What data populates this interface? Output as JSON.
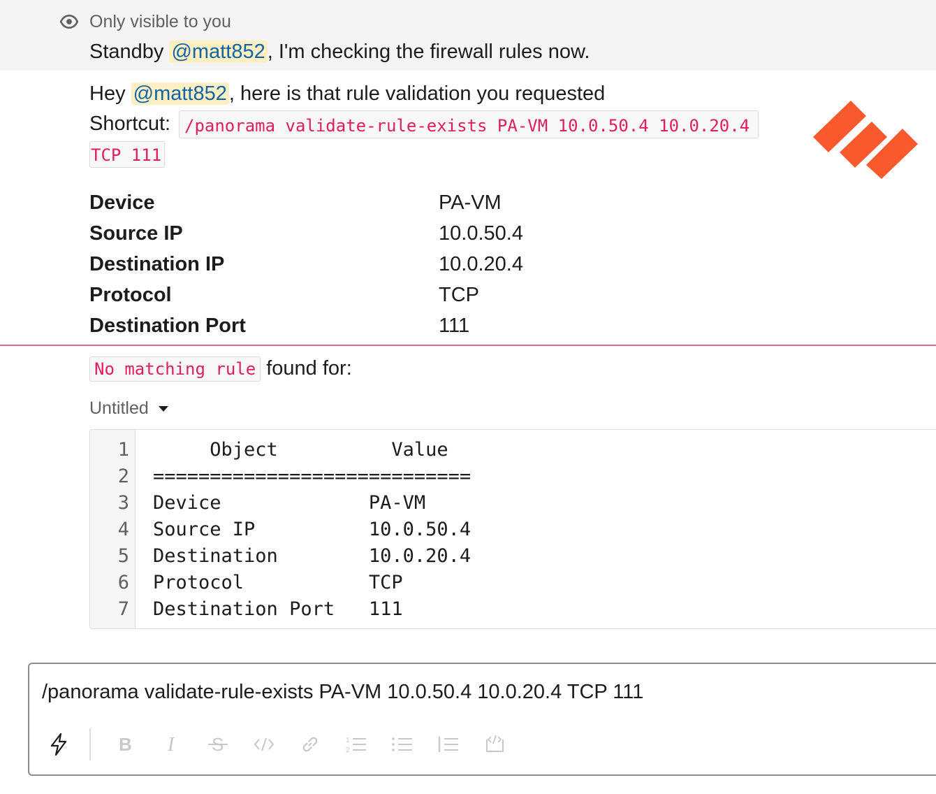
{
  "ephemeral": {
    "visibility_label": "Only visible to you",
    "text_before": "Standby ",
    "mention": "@matt852",
    "text_after": ", I'm checking the firewall rules now."
  },
  "message": {
    "greeting_before": "Hey ",
    "mention": "@matt852",
    "greeting_after": ", here is that rule validation you requested",
    "shortcut_label": "Shortcut: ",
    "shortcut_code_line1": "/panorama validate-rule-exists PA-VM 10.0.50.4 10.0.20.4",
    "shortcut_code_line2": "TCP 111",
    "fields": [
      {
        "key": "Device",
        "value": "PA-VM"
      },
      {
        "key": "Source IP",
        "value": "10.0.50.4"
      },
      {
        "key": "Destination IP",
        "value": "10.0.20.4"
      },
      {
        "key": "Protocol",
        "value": "TCP"
      },
      {
        "key": "Destination Port",
        "value": "111"
      }
    ],
    "result_code": "No matching rule",
    "result_text": " found for:"
  },
  "snippet": {
    "title": "Untitled",
    "lines": [
      {
        "num": "1",
        "text": "     Object          Value"
      },
      {
        "num": "2",
        "text": "============================"
      },
      {
        "num": "3",
        "text": "Device             PA-VM"
      },
      {
        "num": "4",
        "text": "Source IP          10.0.50.4"
      },
      {
        "num": "5",
        "text": "Destination        10.0.20.4"
      },
      {
        "num": "6",
        "text": "Protocol           TCP"
      },
      {
        "num": "7",
        "text": "Destination Port   111"
      }
    ]
  },
  "composer": {
    "input_value": "/panorama validate-rule-exists PA-VM 10.0.50.4 10.0.20.4 TCP 111",
    "toolbar": [
      "shortcuts-icon",
      "bold-icon",
      "italic-icon",
      "strikethrough-icon",
      "code-icon",
      "link-icon",
      "ordered-list-icon",
      "bulleted-list-icon",
      "blockquote-icon",
      "code-block-icon"
    ]
  },
  "colors": {
    "mention_bg": "#fcefc3",
    "mention_text": "#1264a3",
    "code_text": "#e01e5a",
    "logo": "#fa582d"
  }
}
